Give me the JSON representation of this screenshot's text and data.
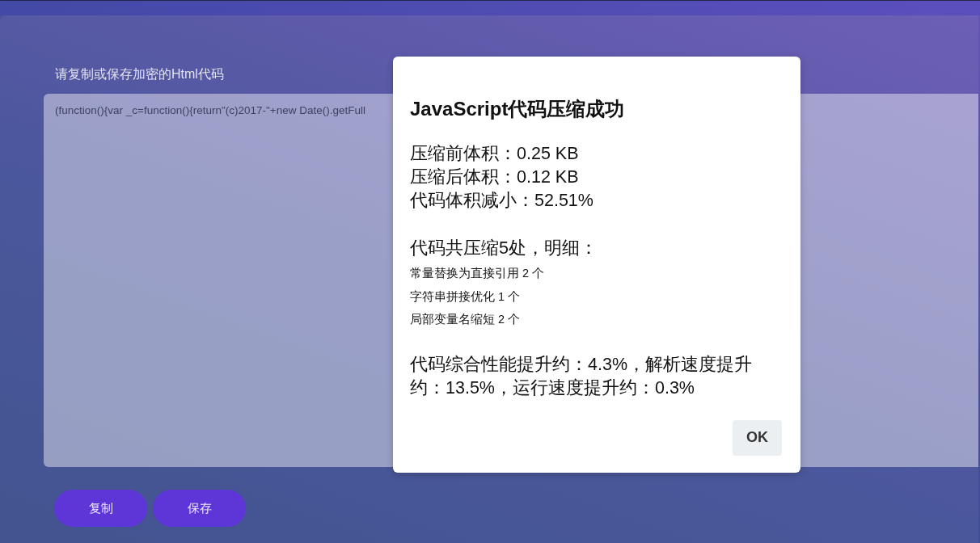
{
  "page": {
    "heading": "请复制或保存加密的Html代码",
    "code_output": {
      "value": "(function(){var _c=function(){return\"(c)2017-\"+new Date().getFull"
    },
    "buttons": [
      {
        "label": "复制"
      },
      {
        "label": "保存"
      }
    ]
  },
  "dialog": {
    "title": "JavaScript代码压缩成功",
    "stats": [
      "压缩前体积：0.25 KB",
      "压缩后体积：0.12 KB",
      "代码体积减小：52.51%"
    ],
    "detail_heading": "代码共压缩5处，明细：",
    "details": [
      "常量替换为直接引用 2 个",
      "字符串拼接优化 1 个",
      "局部变量名缩短 2 个"
    ],
    "summary": "代码综合性能提升约：4.3%，解析速度提升约：13.5%，运行速度提升约：0.3%",
    "ok_button": "OK"
  }
}
